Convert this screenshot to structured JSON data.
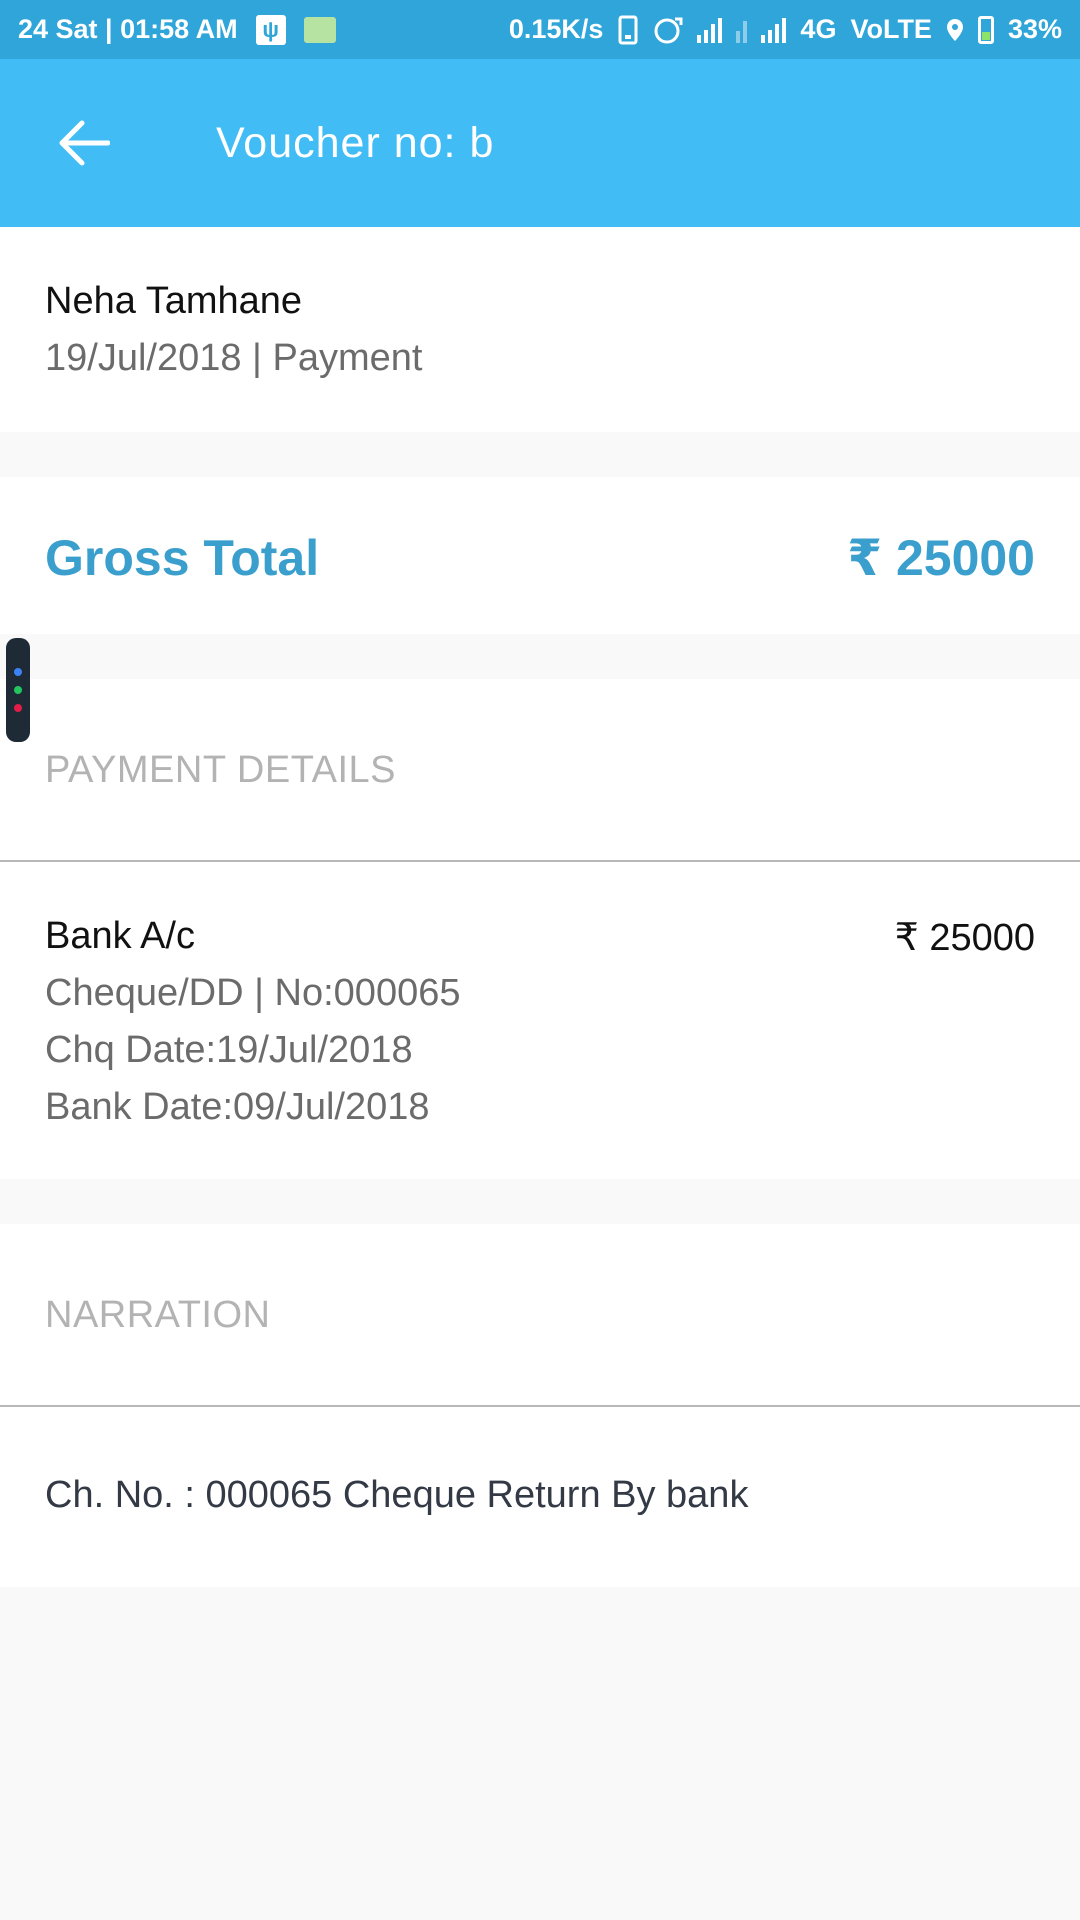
{
  "status_bar": {
    "datetime": "24 Sat | 01:58 AM",
    "speed": "0.15K/s",
    "network": "4G",
    "volte": "VoLTE",
    "battery": "33%"
  },
  "app_bar": {
    "title": "Voucher no: b"
  },
  "party": {
    "name": "Neha Tamhane",
    "subtitle": "19/Jul/2018 | Payment"
  },
  "gross": {
    "label": "Gross Total",
    "value": "₹ 25000"
  },
  "payment_details": {
    "heading": "PAYMENT DETAILS",
    "account": "Bank A/c",
    "amount": "₹ 25000",
    "mode": "Cheque/DD | No:000065",
    "chq_date": "Chq Date:19/Jul/2018",
    "bank_date": "Bank Date:09/Jul/2018"
  },
  "narration": {
    "heading": "NARRATION",
    "text": "Ch. No. : 000065 Cheque Return By bank"
  },
  "colors": {
    "app_bar": "#42bcf5",
    "status_bar": "#2fa5d9",
    "accent": "#3b9fcd"
  }
}
